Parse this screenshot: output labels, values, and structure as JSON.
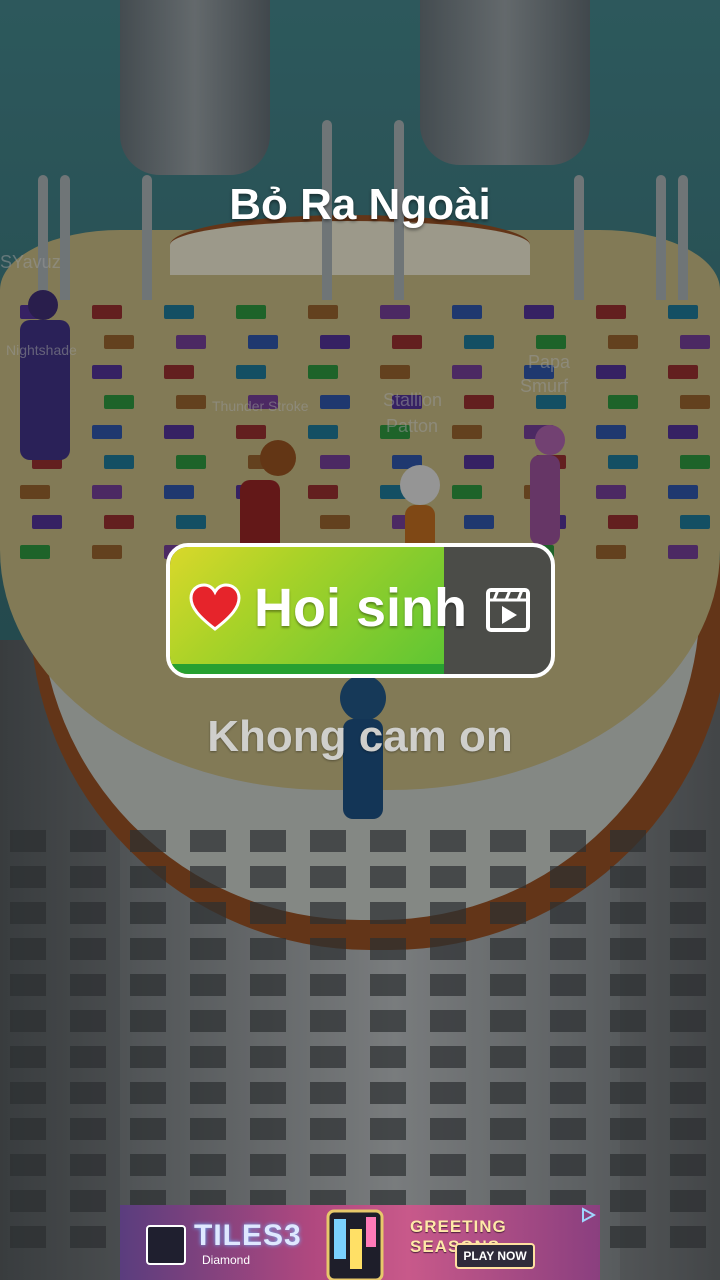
{
  "screen": {
    "title": "Bỏ Ra Ngoài"
  },
  "revive": {
    "label": "Hoi sinh",
    "progress": 0.72,
    "heart_icon": "heart-icon",
    "video_icon": "video-ad-icon"
  },
  "decline": {
    "label": "Khong cam on"
  },
  "players": {
    "names": [
      "SYavuz",
      "Nightshade",
      "Thunder Stroke",
      "Stallion",
      "Patton",
      "Papa",
      "Smurf"
    ]
  },
  "ad": {
    "brand": "TILES3",
    "brand_sub": "Diamond",
    "headline": "GREETING SEASONS",
    "cta": "PLAY NOW",
    "choices_icon": "ad-choices-icon"
  },
  "colors": {
    "revive_fill": "#7fcc2e",
    "revive_empty": "#4b4c48",
    "title_text": "#ffffff",
    "decline_text": "#cfcfcc"
  }
}
